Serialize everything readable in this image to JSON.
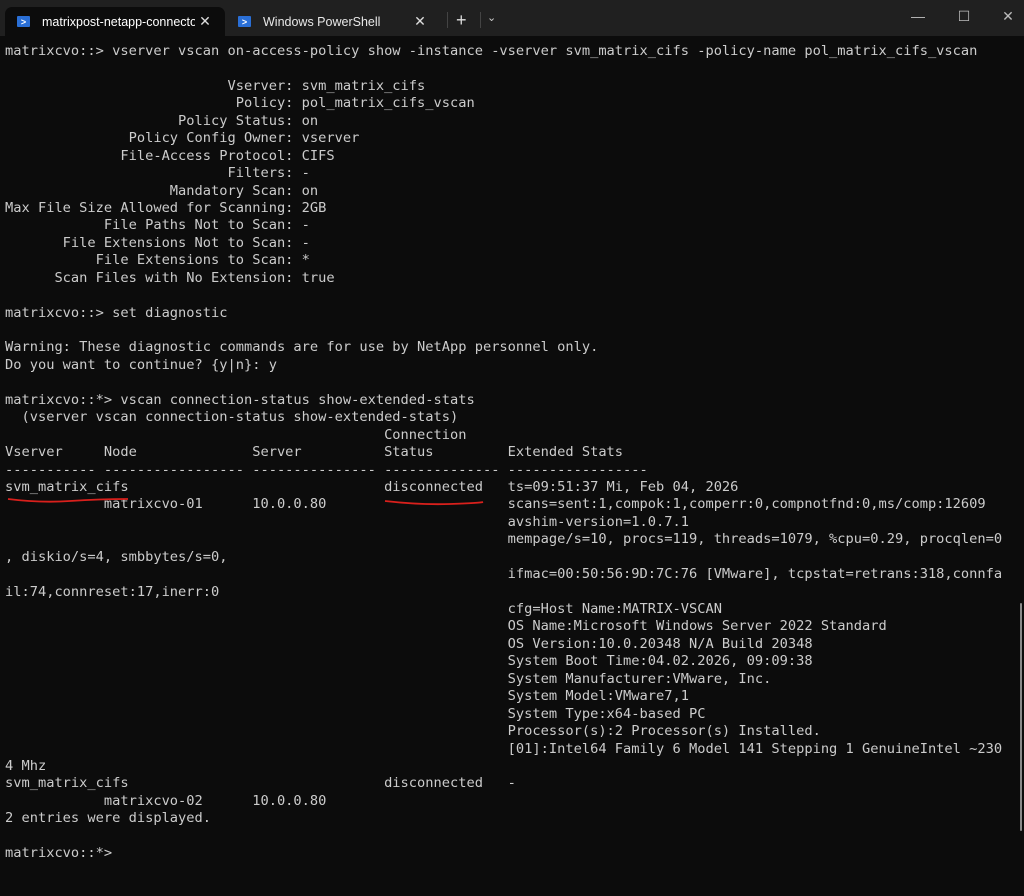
{
  "window": {
    "tabs": [
      {
        "label": "matrixpost-netapp-connector",
        "icon": "powershell-icon",
        "active": true
      },
      {
        "label": "Windows PowerShell",
        "icon": "powershell-icon",
        "active": false
      }
    ],
    "new_tab": "+",
    "dropdown": "⌄",
    "close_glyph": "✕",
    "minimize": "—",
    "maximize": "☐",
    "close": "✕"
  },
  "colors": {
    "background": "#0c0c0c",
    "text": "#cccccc",
    "annotation": "#d9201c"
  },
  "terminal": {
    "lines": [
      "matrixcvo::> vserver vscan on-access-policy show -instance -vserver svm_matrix_cifs -policy-name pol_matrix_cifs_vscan",
      "",
      "                           Vserver: svm_matrix_cifs",
      "                            Policy: pol_matrix_cifs_vscan",
      "                     Policy Status: on",
      "               Policy Config Owner: vserver",
      "              File-Access Protocol: CIFS",
      "                           Filters: -",
      "                    Mandatory Scan: on",
      "Max File Size Allowed for Scanning: 2GB",
      "            File Paths Not to Scan: -",
      "       File Extensions Not to Scan: -",
      "           File Extensions to Scan: *",
      "      Scan Files with No Extension: true",
      "",
      "matrixcvo::> set diagnostic",
      "",
      "Warning: These diagnostic commands are for use by NetApp personnel only.",
      "Do you want to continue? {y|n}: y",
      "",
      "matrixcvo::*> vscan connection-status show-extended-stats",
      "  (vserver vscan connection-status show-extended-stats)",
      "                                              Connection",
      "Vserver     Node              Server          Status         Extended Stats",
      "----------- ----------------- --------------- -------------- -----------------",
      "svm_matrix_cifs                               disconnected   ts=09:51:37 Mi, Feb 04, 2026",
      "            matrixcvo-01      10.0.0.80                      scans=sent:1,compok:1,comperr:0,compnotfnd:0,ms/comp:12609",
      "                                                             avshim-version=1.0.7.1",
      "                                                             mempage/s=10, procs=119, threads=1079, %cpu=0.29, procqlen=0",
      ", diskio/s=4, smbbytes/s=0,",
      "                                                             ifmac=00:50:56:9D:7C:76 [VMware], tcpstat=retrans:318,connfa",
      "il:74,connreset:17,inerr:0",
      "                                                             cfg=Host Name:MATRIX-VSCAN",
      "                                                             OS Name:Microsoft Windows Server 2022 Standard",
      "                                                             OS Version:10.0.20348 N/A Build 20348",
      "                                                             System Boot Time:04.02.2026, 09:09:38",
      "                                                             System Manufacturer:VMware, Inc.",
      "                                                             System Model:VMware7,1",
      "                                                             System Type:x64-based PC",
      "                                                             Processor(s):2 Processor(s) Installed.",
      "                                                             [01]:Intel64 Family 6 Model 141 Stepping 1 GenuineIntel ~230",
      "4 Mhz",
      "svm_matrix_cifs                               disconnected   -",
      "            matrixcvo-02      10.0.0.80",
      "2 entries were displayed.",
      "",
      "matrixcvo::*>"
    ]
  }
}
